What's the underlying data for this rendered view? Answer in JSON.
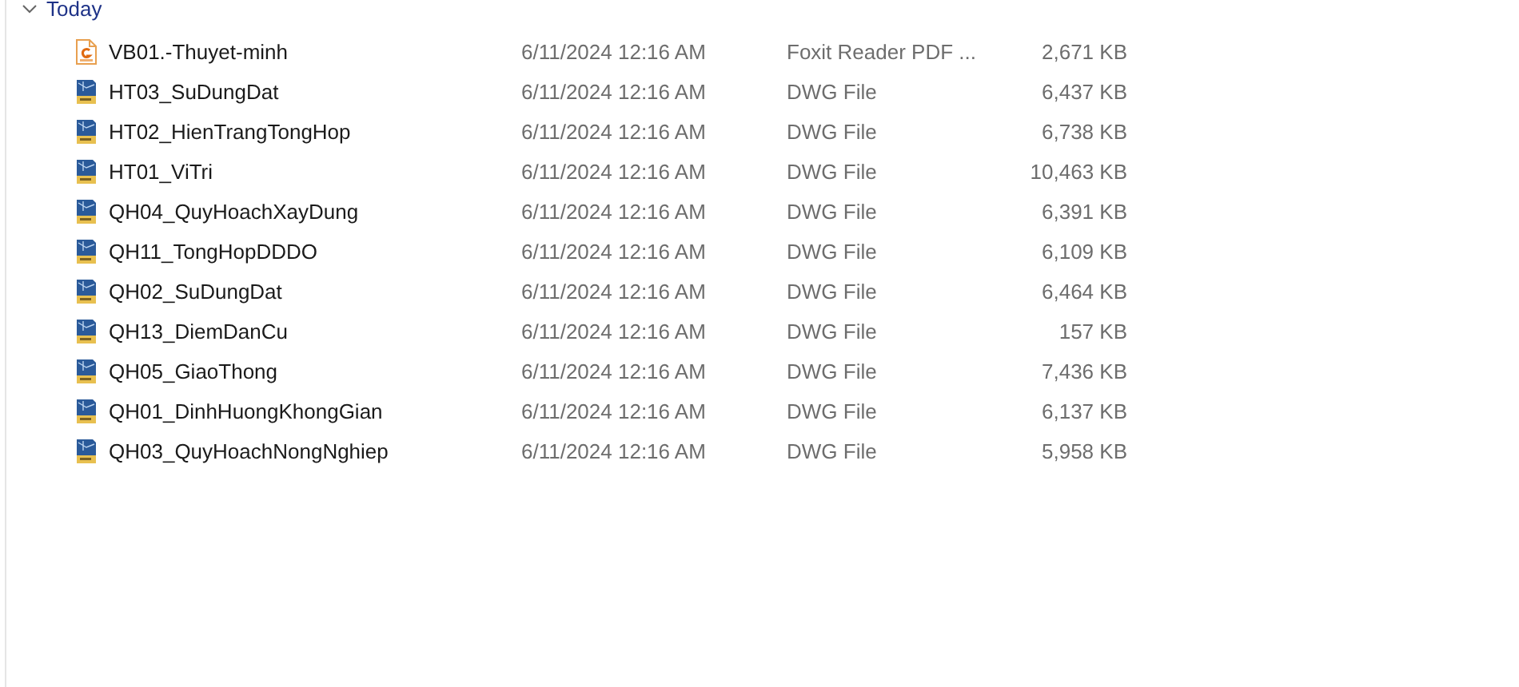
{
  "group": {
    "label": "Today",
    "expanded": true
  },
  "rows": [
    {
      "kind": "pdf",
      "name": "VB01.-Thuyet-minh",
      "date": "6/11/2024 12:16 AM",
      "type": "Foxit Reader PDF ...",
      "size": "2,671 KB"
    },
    {
      "kind": "dwg",
      "name": "HT03_SuDungDat",
      "date": "6/11/2024 12:16 AM",
      "type": "DWG File",
      "size": "6,437 KB"
    },
    {
      "kind": "dwg",
      "name": "HT02_HienTrangTongHop",
      "date": "6/11/2024 12:16 AM",
      "type": "DWG File",
      "size": "6,738 KB"
    },
    {
      "kind": "dwg",
      "name": "HT01_ViTri",
      "date": "6/11/2024 12:16 AM",
      "type": "DWG File",
      "size": "10,463 KB"
    },
    {
      "kind": "dwg",
      "name": "QH04_QuyHoachXayDung",
      "date": "6/11/2024 12:16 AM",
      "type": "DWG File",
      "size": "6,391 KB"
    },
    {
      "kind": "dwg",
      "name": "QH11_TongHopDDDO",
      "date": "6/11/2024 12:16 AM",
      "type": "DWG File",
      "size": "6,109 KB"
    },
    {
      "kind": "dwg",
      "name": "QH02_SuDungDat",
      "date": "6/11/2024 12:16 AM",
      "type": "DWG File",
      "size": "6,464 KB"
    },
    {
      "kind": "dwg",
      "name": "QH13_DiemDanCu",
      "date": "6/11/2024 12:16 AM",
      "type": "DWG File",
      "size": "157 KB"
    },
    {
      "kind": "dwg",
      "name": "QH05_GiaoThong",
      "date": "6/11/2024 12:16 AM",
      "type": "DWG File",
      "size": "7,436 KB"
    },
    {
      "kind": "dwg",
      "name": "QH01_DinhHuongKhongGian",
      "date": "6/11/2024 12:16 AM",
      "type": "DWG File",
      "size": "6,137 KB"
    },
    {
      "kind": "dwg",
      "name": "QH03_QuyHoachNongNghiep",
      "date": "6/11/2024 12:16 AM",
      "type": "DWG File",
      "size": "5,958 KB"
    }
  ]
}
